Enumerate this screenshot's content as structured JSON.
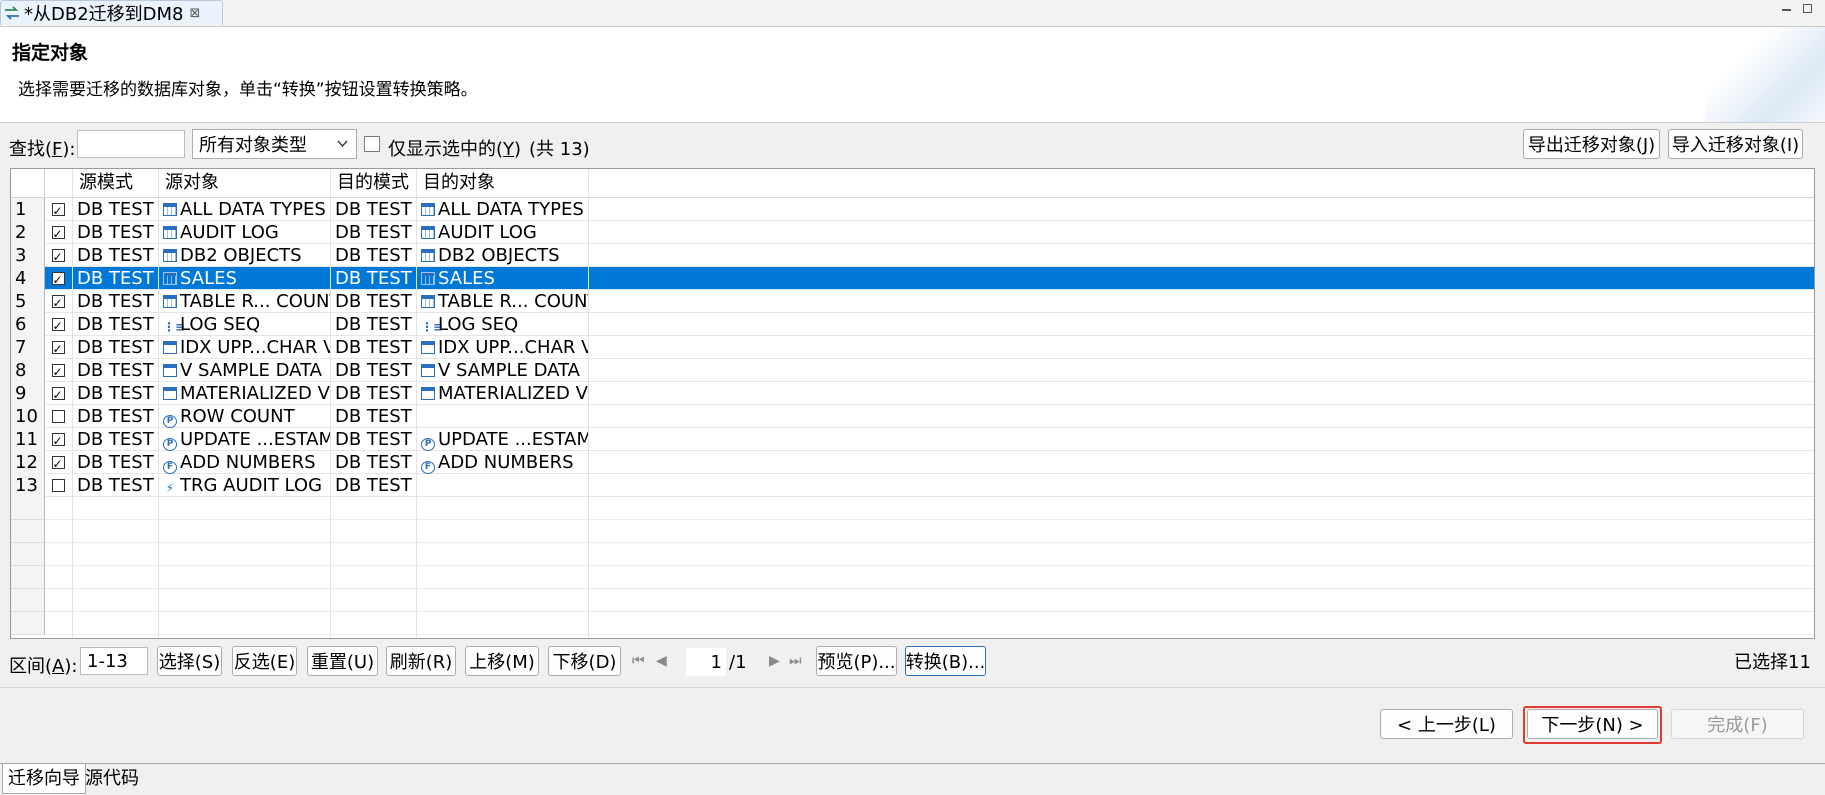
{
  "editor_tab": {
    "title": "*从DB2迁移到DM8",
    "close_glyph": "⊠"
  },
  "header": {
    "title": "指定对象",
    "description": "选择需要迁移的数据库对象，单击“转换”按钮设置转换策略。"
  },
  "filter": {
    "find_label_pre": "查找(",
    "find_key": "F",
    "find_label_post": "):",
    "find_value": "",
    "type_select": "所有对象类型",
    "show_selected_pre": "仅显示选中的(",
    "show_selected_key": "Y",
    "show_selected_post": ")",
    "show_selected_checked": false,
    "total_label": "(共 13)",
    "export_button": "导出迁移对象(J)",
    "import_button": "导入迁移对象(I)"
  },
  "table": {
    "columns": [
      "源模式",
      "源对象",
      "目的模式",
      "目的对象"
    ],
    "rows": [
      {
        "num": "1",
        "checked": true,
        "src_schema": "DB TEST",
        "src_icon": "table-icon",
        "src_obj": "ALL DATA TYPES",
        "dst_schema": "DB TEST",
        "dst_icon": "table-icon",
        "dst_obj": "ALL DATA TYPES",
        "selected": false
      },
      {
        "num": "2",
        "checked": true,
        "src_schema": "DB TEST",
        "src_icon": "table-icon",
        "src_obj": "AUDIT LOG",
        "dst_schema": "DB TEST",
        "dst_icon": "table-icon",
        "dst_obj": "AUDIT LOG",
        "selected": false
      },
      {
        "num": "3",
        "checked": true,
        "src_schema": "DB TEST",
        "src_icon": "table-icon",
        "src_obj": "DB2 OBJECTS",
        "dst_schema": "DB TEST",
        "dst_icon": "table-icon",
        "dst_obj": "DB2 OBJECTS",
        "selected": false
      },
      {
        "num": "4",
        "checked": true,
        "src_schema": "DB TEST",
        "src_icon": "table-icon",
        "src_obj": "SALES",
        "dst_schema": "DB TEST",
        "dst_icon": "table-icon",
        "dst_obj": "SALES",
        "selected": true
      },
      {
        "num": "5",
        "checked": true,
        "src_schema": "DB TEST",
        "src_icon": "table-icon",
        "src_obj": "TABLE R... COUNT",
        "dst_schema": "DB TEST",
        "dst_icon": "table-icon",
        "dst_obj": "TABLE R... COUNT",
        "selected": false
      },
      {
        "num": "6",
        "checked": true,
        "src_schema": "DB TEST",
        "src_icon": "sequence-icon",
        "src_obj": "LOG SEQ",
        "dst_schema": "DB TEST",
        "dst_icon": "sequence-icon",
        "dst_obj": "LOG SEQ",
        "selected": false
      },
      {
        "num": "7",
        "checked": true,
        "src_schema": "DB TEST",
        "src_icon": "view-icon",
        "src_obj": "IDX UPP...CHAR V",
        "dst_schema": "DB TEST",
        "dst_icon": "view-icon",
        "dst_obj": "IDX UPP...CHAR V",
        "selected": false
      },
      {
        "num": "8",
        "checked": true,
        "src_schema": "DB TEST",
        "src_icon": "view-icon",
        "src_obj": "V SAMPLE DATA",
        "dst_schema": "DB TEST",
        "dst_icon": "view-icon",
        "dst_obj": "V SAMPLE DATA",
        "selected": false
      },
      {
        "num": "9",
        "checked": true,
        "src_schema": "DB TEST",
        "src_icon": "view-icon",
        "src_obj": "MATERIALIZED VIEW",
        "dst_schema": "DB TEST",
        "dst_icon": "view-icon",
        "dst_obj": "MATERIALIZED VIEW",
        "selected": false
      },
      {
        "num": "10",
        "checked": false,
        "src_schema": "DB TEST",
        "src_icon": "procedure-icon",
        "src_obj": "ROW COUNT",
        "dst_schema": "DB TEST",
        "dst_icon": "",
        "dst_obj": "",
        "selected": false
      },
      {
        "num": "11",
        "checked": true,
        "src_schema": "DB TEST",
        "src_icon": "procedure-icon",
        "src_obj": "UPDATE ...ESTAMP",
        "dst_schema": "DB TEST",
        "dst_icon": "procedure-icon",
        "dst_obj": "UPDATE ...ESTAMP",
        "selected": false
      },
      {
        "num": "12",
        "checked": true,
        "src_schema": "DB TEST",
        "src_icon": "function-icon",
        "src_obj": "ADD NUMBERS",
        "dst_schema": "DB TEST",
        "dst_icon": "function-icon",
        "dst_obj": "ADD NUMBERS",
        "selected": false
      },
      {
        "num": "13",
        "checked": false,
        "src_schema": "DB TEST",
        "src_icon": "trigger-icon",
        "src_obj": "TRG AUDIT LOG",
        "dst_schema": "DB TEST",
        "dst_icon": "",
        "dst_obj": "",
        "selected": false
      }
    ]
  },
  "range_bar": {
    "range_label_pre": "区间(",
    "range_key": "A",
    "range_label_post": "):",
    "range_value": "1-13",
    "select_button": "选择(S)",
    "invert_button": "反选(E)",
    "reset_button": "重置(U)",
    "refresh_button": "刷新(R)",
    "up_button": "上移(M)",
    "down_button": "下移(D)",
    "first_glyph": "⏮",
    "prev_glyph": "◀",
    "page_value": "1",
    "page_total": "/1",
    "next_glyph": "▶",
    "last_glyph": "⏭",
    "preview_button": "预览(P)...",
    "convert_button": "转换(B)...",
    "selected_count": "已选择11"
  },
  "wizard": {
    "back_button": "< 上一步(L)",
    "next_button": "下一步(N) >",
    "finish_button": "完成(F)"
  },
  "bottom_tabs": [
    "迁移向导",
    "源代码"
  ]
}
